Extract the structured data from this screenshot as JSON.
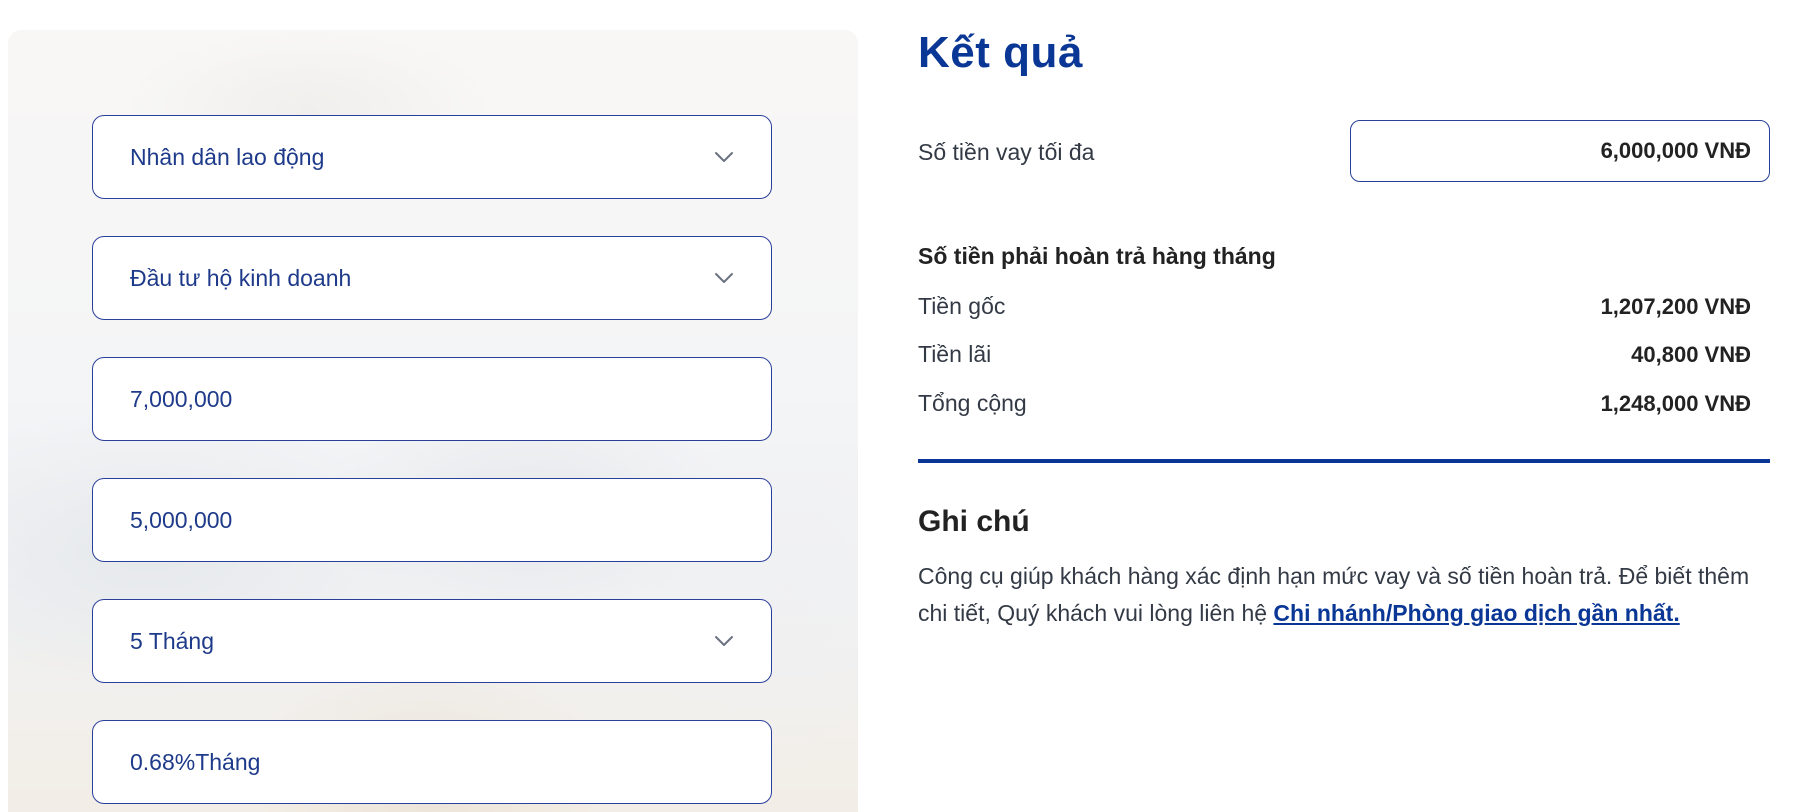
{
  "form": {
    "fields": [
      {
        "value": "Nhân dân lao động",
        "has_dropdown": true
      },
      {
        "value": "Đầu tư hộ kinh doanh",
        "has_dropdown": true
      },
      {
        "value": "7,000,000",
        "has_dropdown": false
      },
      {
        "value": "5,000,000",
        "has_dropdown": false
      },
      {
        "value": "5 Tháng",
        "has_dropdown": true
      },
      {
        "value": "0.68%Tháng",
        "has_dropdown": false
      }
    ]
  },
  "result": {
    "title": "Kết quả",
    "max_loan_label": "Số tiền vay tối đa",
    "max_loan_value": "6,000,000 VNĐ",
    "monthly_heading": "Số tiền phải hoàn trả hàng tháng",
    "rows": [
      {
        "label": "Tiền gốc",
        "value": "1,207,200 VNĐ"
      },
      {
        "label": "Tiền lãi",
        "value": "40,800 VNĐ"
      },
      {
        "label": "Tổng cộng",
        "value": "1,248,000 VNĐ"
      }
    ]
  },
  "note": {
    "title": "Ghi chú",
    "text": "Công cụ giúp khách hàng xác định hạn mức vay và số tiền hoàn trả. Để biết thêm chi tiết, Quý khách vui lòng liên hệ ",
    "link_text": "Chi nhánh/Phòng giao dịch gần nhất."
  },
  "colors": {
    "brand_blue": "#0a3796",
    "field_border": "#2a3f9a",
    "field_text": "#1e3a8a"
  },
  "icons": {
    "dropdown": "chevron-down-icon"
  }
}
